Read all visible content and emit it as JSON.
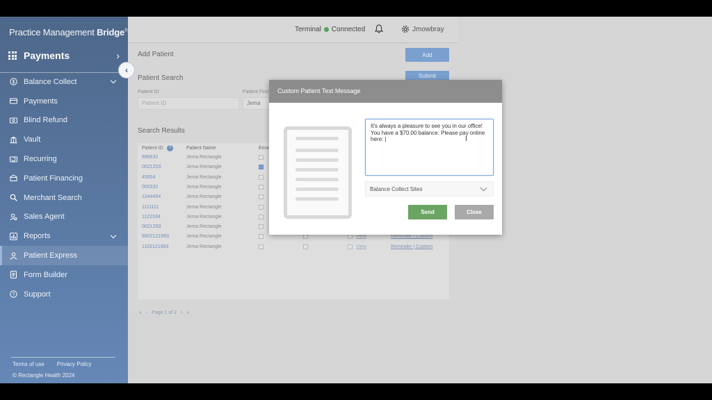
{
  "sidebar": {
    "brand_light": "Practice Management ",
    "brand_bold": "Bridge",
    "brand_mark": "®",
    "module_label": "Payments",
    "items": [
      {
        "label": "Balance Collect",
        "icon": "dollar-circle-icon",
        "expandable": true
      },
      {
        "label": "Payments",
        "icon": "card-icon"
      },
      {
        "label": "Blind Refund",
        "icon": "cash-icon"
      },
      {
        "label": "Vault",
        "icon": "bank-icon"
      },
      {
        "label": "Recurring",
        "icon": "recurring-icon"
      },
      {
        "label": "Patient Financing",
        "icon": "financing-icon"
      },
      {
        "label": "Merchant Search",
        "icon": "search-icon"
      },
      {
        "label": "Sales Agent",
        "icon": "agent-icon"
      },
      {
        "label": "Reports",
        "icon": "reports-icon",
        "expandable": true
      },
      {
        "label": "Patient Express",
        "icon": "person-icon",
        "active": true
      },
      {
        "label": "Form Builder",
        "icon": "form-icon"
      },
      {
        "label": "Support",
        "icon": "help-icon"
      }
    ],
    "footer": {
      "terms": "Terms of use",
      "privacy": "Privacy Policy",
      "copyright": "© Rectangle Health 2024"
    }
  },
  "topbar": {
    "terminal_label": "Terminal",
    "terminal_status": "Connected",
    "status_color": "#57a15b",
    "username": "Jmowbray"
  },
  "background": {
    "add_patient_title": "Add Patient",
    "add_button": "Add",
    "patient_search_title": "Patient Search",
    "submit_button": "Submit",
    "patient_id_label": "Patient ID",
    "patient_id_placeholder": "Patient ID",
    "patient_first_label": "Patient First",
    "patient_first_value": "Jema",
    "search_results_title": "Search Results",
    "col_patient_id": "Patient ID",
    "col_patient_name": "Patient Name",
    "col_email": "Emai",
    "rows": [
      {
        "id": "696632",
        "name": "Jema Rectangle",
        "checked": false
      },
      {
        "id": "0021203",
        "name": "Jema Rectangle",
        "checked": true
      },
      {
        "id": "45654",
        "name": "Jema Rectangle",
        "checked": false
      },
      {
        "id": "000332",
        "name": "Jema Rectangle",
        "checked": false
      },
      {
        "id": "1244454",
        "name": "Jema Rectangle",
        "checked": false
      },
      {
        "id": "1111111",
        "name": "Jema Rectangle",
        "checked": false
      },
      {
        "id": "1122334",
        "name": "Jema Rectangle",
        "checked": false
      },
      {
        "id": "0021293",
        "name": "Jema Rectangle",
        "checked": false
      },
      {
        "id": "8802121993",
        "name": "Jema Rectangle",
        "checked": false,
        "view": "View",
        "actions": "Reminder | Custom"
      },
      {
        "id": "1102121993",
        "name": "Jema Rectangle",
        "checked": false,
        "view": "View",
        "actions": "Reminder | Custom"
      }
    ],
    "pager": {
      "first": "«",
      "prev": "‹",
      "text": "Page 1 of 2",
      "next": "›",
      "last": "»"
    }
  },
  "modal": {
    "title": "Custom Patient Text Message",
    "message": "It's always a pleasure to see you in our office! You have a $70.00 balance. Please pay online here: |",
    "select_value": "Balance Collect Sites",
    "send_label": "Send",
    "close_label": "Close",
    "send_color": "#6aa563",
    "close_color": "#a9a9a9"
  }
}
